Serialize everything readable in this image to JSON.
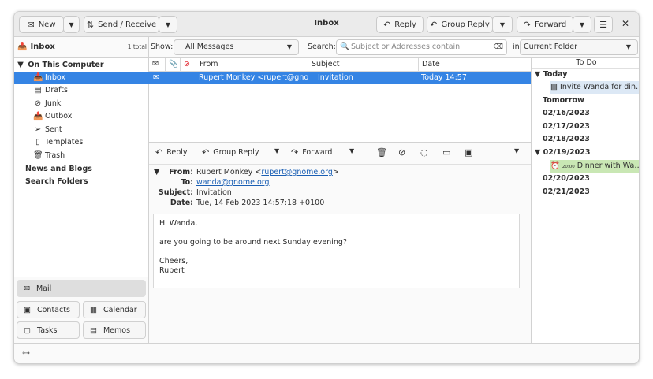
{
  "window": {
    "title": "Inbox"
  },
  "toolbar": {
    "new_label": "New",
    "send_receive_label": "Send / Receive",
    "reply_label": "Reply",
    "group_reply_label": "Group Reply",
    "forward_label": "Forward"
  },
  "folder_header": {
    "title": "Inbox",
    "count": "1 total"
  },
  "filter": {
    "show_label": "Show:",
    "show_value": "All Messages",
    "search_label": "Search:",
    "search_placeholder": "Subject or Addresses contain",
    "in_label": "in",
    "scope_value": "Current Folder"
  },
  "folders": {
    "account": "On This Computer",
    "items": [
      {
        "label": "Inbox",
        "icon": "inbox-icon",
        "selected": true
      },
      {
        "label": "Drafts",
        "icon": "drafts-icon"
      },
      {
        "label": "Junk",
        "icon": "junk-icon"
      },
      {
        "label": "Outbox",
        "icon": "outbox-icon"
      },
      {
        "label": "Sent",
        "icon": "sent-icon"
      },
      {
        "label": "Templates",
        "icon": "templates-icon"
      },
      {
        "label": "Trash",
        "icon": "trash-icon"
      }
    ],
    "news_and_blogs": "News and Blogs",
    "search_folders": "Search Folders"
  },
  "switcher": {
    "mail": "Mail",
    "contacts": "Contacts",
    "calendar": "Calendar",
    "tasks": "Tasks",
    "memos": "Memos"
  },
  "message_list": {
    "columns": {
      "from": "From",
      "subject": "Subject",
      "date": "Date"
    },
    "rows": [
      {
        "from": "Rupert Monkey <rupert@gno…",
        "subject": "Invitation",
        "date": "Today 14:57",
        "selected": true
      }
    ]
  },
  "preview_toolbar": {
    "reply": "Reply",
    "group_reply": "Group Reply",
    "forward": "Forward"
  },
  "message": {
    "from_label": "From:",
    "from_name": "Rupert Monkey <",
    "from_email": "rupert@gnome.org",
    "from_close": ">",
    "to_label": "To:",
    "to_email": "wanda@gnome.org",
    "subject_label": "Subject:",
    "subject": "Invitation",
    "date_label": "Date:",
    "date": "Tue, 14 Feb 2023 14:57:18 +0100",
    "body": {
      "greeting": "Hi Wanda,",
      "line1": "are you going to be around next Sunday evening?",
      "closing": "Cheers,",
      "signature": "Rupert"
    }
  },
  "todo": {
    "title": "To Do",
    "today": "Today",
    "today_task": "Invite Wanda for din…",
    "tomorrow": "Tomorrow",
    "dates": [
      "02/16/2023",
      "02/17/2023",
      "02/18/2023"
    ],
    "date_0219": "02/19/2023",
    "event_time": "20:00",
    "event_title": "Dinner with Wa…",
    "dates_after": [
      "02/20/2023",
      "02/21/2023"
    ]
  },
  "colors": {
    "selection": "#3584e4",
    "task_highlight": "#dce8f5",
    "event_highlight": "#c9e7b4",
    "link": "#1a5fb4",
    "importance_red": "#e01b24"
  }
}
